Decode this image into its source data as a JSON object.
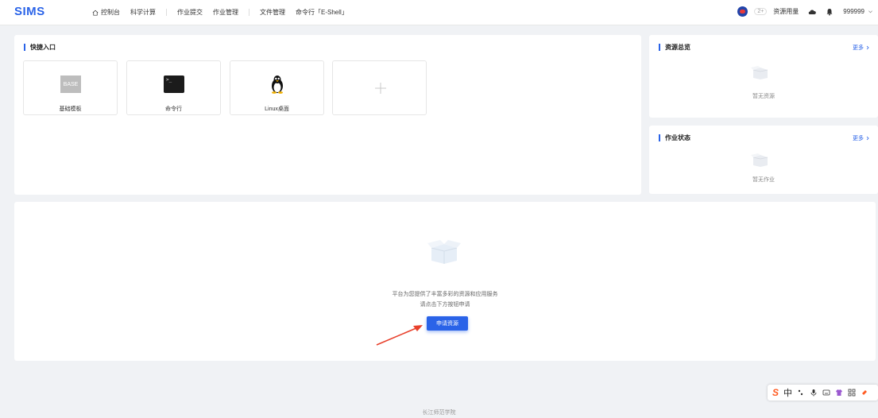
{
  "app": {
    "logo": "SIMS",
    "nav": {
      "console": "控制台",
      "science": "科学计算",
      "job_submit": "作业提交",
      "job_manage": "作业管理",
      "file_manage": "文件管理",
      "shell": "命令行「E-Shell」"
    },
    "topright": {
      "badge": "2+",
      "usage": "资源用量",
      "username": "999999"
    }
  },
  "quick_entry": {
    "title": "快捷入口",
    "cards": [
      {
        "icon_text": "BASE",
        "label": "基础模板"
      },
      {
        "icon_text": ">_",
        "label": "命令行"
      },
      {
        "label": "Linux桌面"
      }
    ]
  },
  "resource_overview": {
    "title": "资源总览",
    "more": "更多",
    "empty": "暂无资源"
  },
  "job_status": {
    "title": "作业状态",
    "more": "更多",
    "empty": "暂无作业"
  },
  "main": {
    "line1": "平台为您提供了丰富多彩的资源和应用服务",
    "line2": "请点击下方按钮申请",
    "button": "申请资源"
  },
  "footer": "长江师范学院",
  "ime": {
    "zh": "中"
  },
  "colors": {
    "accent": "#2a63e8",
    "arrow": "#e8402b",
    "ime_logo": "#ff5b22"
  }
}
